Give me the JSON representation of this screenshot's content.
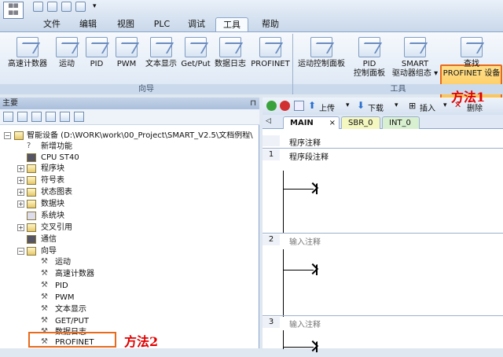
{
  "tabs": [
    "文件",
    "编辑",
    "视图",
    "PLC",
    "调试",
    "工具",
    "帮助"
  ],
  "ribbon": {
    "buttons": [
      "高速计数器",
      "运动",
      "PID",
      "PWM",
      "文本显示",
      "Get/Put",
      "数据日志",
      "PROFINET",
      "运动控制面板",
      "PID",
      "控制面板",
      "SMART",
      "驱动器组态",
      "查找",
      "PROFINET 设备"
    ],
    "group_wizard": "向导",
    "group_tools": "工具",
    "annotation1": "方法1"
  },
  "left": {
    "title": "主要",
    "tree": [
      "智能设备 (D:\\WORK\\work\\00_Project\\SMART_V2.5\\文档例程\\",
      "新增功能",
      "CPU ST40",
      "程序块",
      "符号表",
      "状态图表",
      "数据块",
      "系统块",
      "交叉引用",
      "通信",
      "向导",
      "运动",
      "高速计数器",
      "PID",
      "PWM",
      "文本显示",
      "GET/PUT",
      "数据日志",
      "PROFINET"
    ],
    "annotation2": "方法2"
  },
  "right": {
    "upload": "上传",
    "download": "下载",
    "insert": "插入",
    "delete": "删除",
    "tabs": [
      "MAIN",
      "SBR_0",
      "INT_0"
    ],
    "prog_comment": "程序注释",
    "networks": [
      {
        "n": "1",
        "comment": "程序段注释"
      },
      {
        "n": "2",
        "comment": "输入注释"
      },
      {
        "n": "3",
        "comment": "输入注释"
      }
    ]
  }
}
